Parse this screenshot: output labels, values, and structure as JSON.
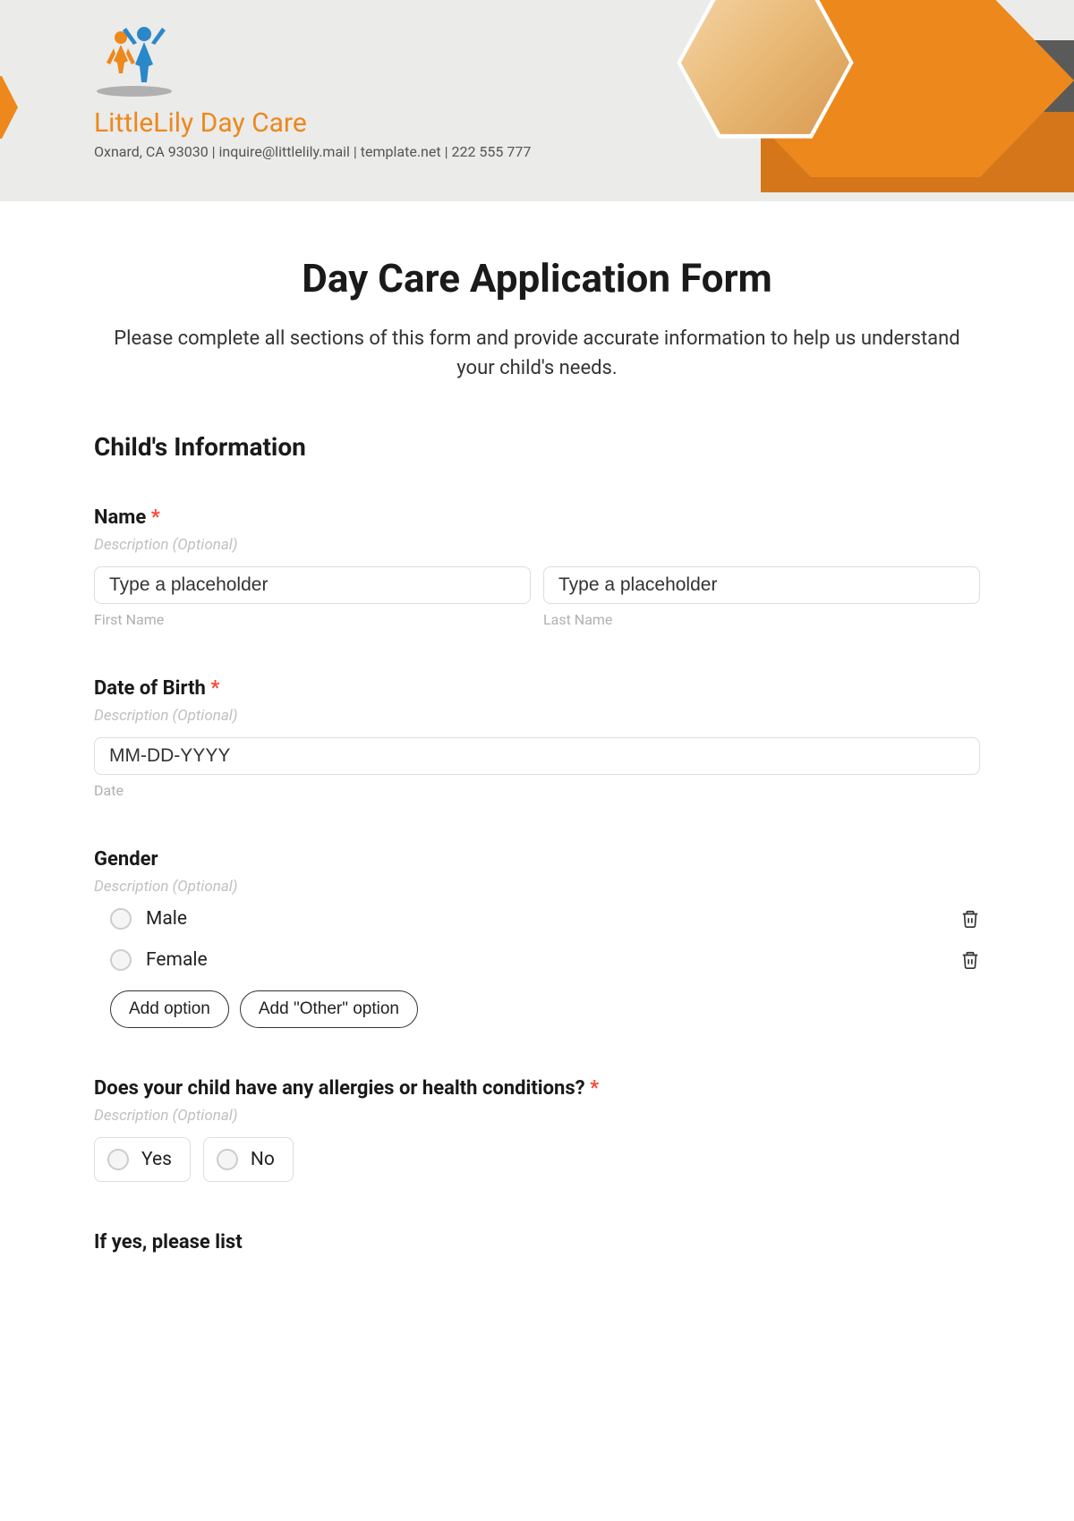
{
  "header": {
    "company_name": "LittleLily Day Care",
    "company_info": "Oxnard, CA 93030 | inquire@littlelily.mail | template.net | 222 555 777"
  },
  "form": {
    "title": "Day Care Application Form",
    "subtitle": "Please complete all sections of this form and provide accurate information to help us understand your child's needs.",
    "section_title": "Child's Information",
    "description_placeholder": "Description (Optional)",
    "name_field": {
      "label": "Name",
      "required": "*",
      "first_placeholder": "Type a placeholder",
      "last_placeholder": "Type a placeholder",
      "first_sublabel": "First Name",
      "last_sublabel": "Last Name"
    },
    "dob_field": {
      "label": "Date of Birth",
      "required": "*",
      "placeholder": "MM-DD-YYYY",
      "sublabel": "Date"
    },
    "gender_field": {
      "label": "Gender",
      "option_male": "Male",
      "option_female": "Female",
      "add_option": "Add option",
      "add_other": "Add \"Other\" option"
    },
    "allergies_field": {
      "label": "Does your child have any allergies or health conditions?",
      "required": "*",
      "yes": "Yes",
      "no": "No"
    },
    "list_field": {
      "label": "If yes, please list"
    }
  }
}
